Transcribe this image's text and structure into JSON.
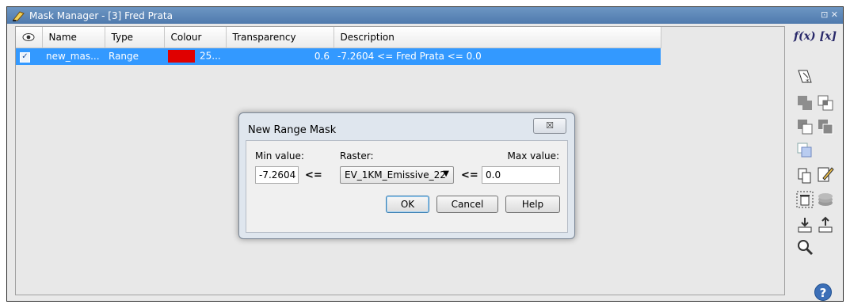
{
  "window": {
    "title": "Mask Manager - [3] Fred Prata",
    "win_controls": "⊡ ✕"
  },
  "table": {
    "headers": {
      "name": "Name",
      "type": "Type",
      "colour": "Colour",
      "transparency": "Transparency",
      "description": "Description"
    },
    "rows": [
      {
        "visible": "✓",
        "name": "new_mas...",
        "type": "Range",
        "colour_hex": "#e00000",
        "colour_text": "25...",
        "transparency": "0.6",
        "description": "-7.2604 <= Fred Prata <= 0.0"
      }
    ]
  },
  "toolbar": {
    "fx_label": "f(x) [x]",
    "help_label": "?"
  },
  "dialog": {
    "title": "New Range Mask",
    "close_label": "☒",
    "min_label": "Min value:",
    "raster_label": "Raster:",
    "max_label": "Max value:",
    "min_value": "-7.2604",
    "raster_value": "EV_1KM_Emissive_22",
    "max_value": "0.0",
    "op_left": "<=",
    "op_right": "<=",
    "ok": "OK",
    "cancel": "Cancel",
    "help": "Help"
  },
  "colors": {
    "selection": "#3399ff",
    "title_bar": "#5a84b6"
  }
}
